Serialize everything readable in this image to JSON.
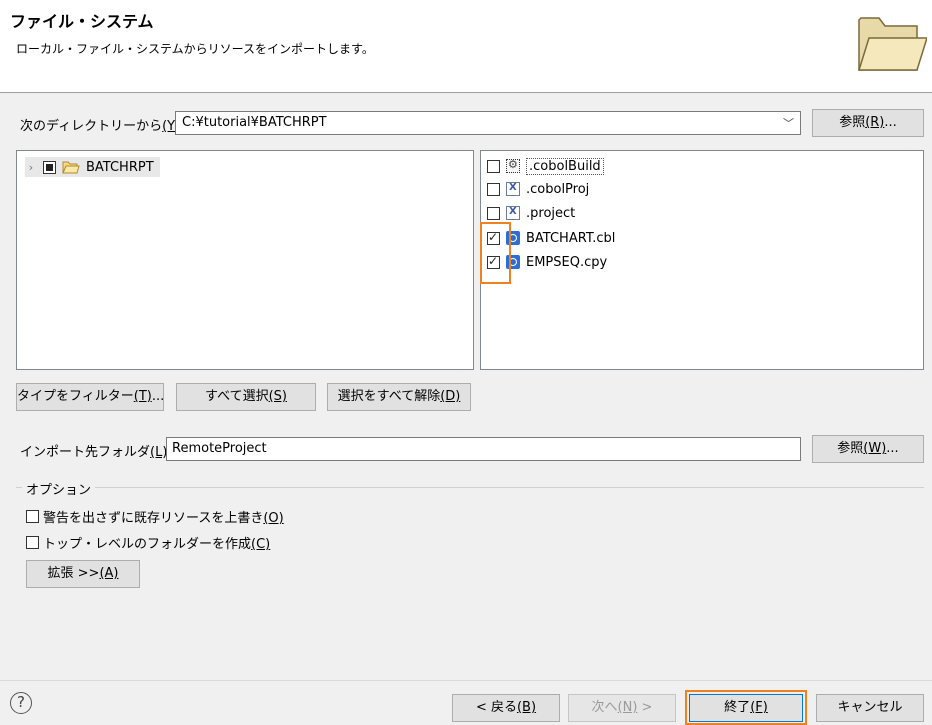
{
  "header": {
    "title": "ファイル・システム",
    "subtitle": "ローカル・ファイル・システムからリソースをインポートします。",
    "icon": "folder-icon"
  },
  "source": {
    "label": "次のディレクトリーから",
    "mnemonic": "(Y)",
    "colon": ":",
    "value": "C:¥tutorial¥BATCHRPT",
    "browse_label": "参照",
    "browse_mnemonic": "(R)",
    "browse_suffix": "..."
  },
  "tree": {
    "items": [
      {
        "label": "BATCHRPT",
        "icon": "folder-open-icon",
        "state": "partial"
      }
    ]
  },
  "files": [
    {
      "name": ".cobolBuild",
      "checked": false,
      "icon": "build-icon"
    },
    {
      "name": ".cobolProj",
      "checked": false,
      "icon": "xml-file-icon"
    },
    {
      "name": ".project",
      "checked": false,
      "icon": "xml-file-icon"
    },
    {
      "name": "BATCHART.cbl",
      "checked": true,
      "icon": "cobol-file-icon"
    },
    {
      "name": "EMPSEQ.cpy",
      "checked": true,
      "icon": "cobol-file-icon"
    }
  ],
  "filter_buttons": {
    "filter_label": "タイプをフィルター",
    "filter_mnemonic": "(T)",
    "filter_suffix": "...",
    "select_all_label": "すべて選択",
    "select_all_mnemonic": "(S)",
    "deselect_all_label": "選択をすべて解除",
    "deselect_all_mnemonic": "(D)"
  },
  "destination": {
    "label": "インポート先フォルダ",
    "mnemonic": "(L)",
    "colon": ":",
    "value": "RemoteProject",
    "browse_label": "参照",
    "browse_mnemonic": "(W)",
    "browse_suffix": "..."
  },
  "options": {
    "title": "オプション",
    "overwrite_label": "警告を出さずに既存リソースを上書き",
    "overwrite_mnemonic": "(O)",
    "overwrite_checked": false,
    "toplevel_label": "トップ・レベルのフォルダーを作成",
    "toplevel_mnemonic": "(C)",
    "toplevel_checked": false,
    "advanced_label": "拡張 >>",
    "advanced_mnemonic": "(A)"
  },
  "footer": {
    "help_glyph": "?",
    "back_label": "< 戻る",
    "back_mnemonic": "(B)",
    "next_label": "次へ",
    "next_mnemonic": "(N)",
    "next_suffix": " >",
    "finish_label": "終了",
    "finish_mnemonic": "(F)",
    "cancel_label": "キャンセル"
  },
  "colors": {
    "highlight": "#f08020",
    "accent": "#2d6fd1"
  }
}
